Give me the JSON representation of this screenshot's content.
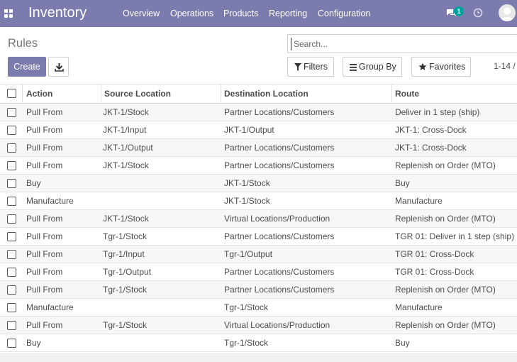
{
  "navbar": {
    "app_title": "Inventory",
    "menu": [
      "Overview",
      "Operations",
      "Products",
      "Reporting",
      "Configuration"
    ],
    "chat_badge": "1",
    "color": "#7c7bad"
  },
  "control_panel": {
    "breadcrumb": "Rules",
    "search_placeholder": "Search...",
    "create_label": "Create",
    "filters_label": "Filters",
    "group_by_label": "Group By",
    "favorites_label": "Favorites",
    "pager": "1-14 /"
  },
  "table": {
    "columns": [
      "Action",
      "Source Location",
      "Destination Location",
      "Route"
    ],
    "rows": [
      {
        "action": "Pull From",
        "source": "JKT-1/Stock",
        "destination": "Partner Locations/Customers",
        "route": "Deliver in 1 step (ship)"
      },
      {
        "action": "Pull From",
        "source": "JKT-1/Input",
        "destination": "JKT-1/Output",
        "route": "JKT-1: Cross-Dock"
      },
      {
        "action": "Pull From",
        "source": "JKT-1/Output",
        "destination": "Partner Locations/Customers",
        "route": "JKT-1: Cross-Dock"
      },
      {
        "action": "Pull From",
        "source": "JKT-1/Stock",
        "destination": "Partner Locations/Customers",
        "route": "Replenish on Order (MTO)"
      },
      {
        "action": "Buy",
        "source": "",
        "destination": "JKT-1/Stock",
        "route": "Buy"
      },
      {
        "action": "Manufacture",
        "source": "",
        "destination": "JKT-1/Stock",
        "route": "Manufacture"
      },
      {
        "action": "Pull From",
        "source": "JKT-1/Stock",
        "destination": "Virtual Locations/Production",
        "route": "Replenish on Order (MTO)"
      },
      {
        "action": "Pull From",
        "source": "Tgr-1/Stock",
        "destination": "Partner Locations/Customers",
        "route": "TGR 01: Deliver in 1 step (ship)"
      },
      {
        "action": "Pull From",
        "source": "Tgr-1/Input",
        "destination": "Tgr-1/Output",
        "route": "TGR 01: Cross-Dock"
      },
      {
        "action": "Pull From",
        "source": "Tgr-1/Output",
        "destination": "Partner Locations/Customers",
        "route": "TGR 01: Cross-Dock"
      },
      {
        "action": "Pull From",
        "source": "Tgr-1/Stock",
        "destination": "Partner Locations/Customers",
        "route": "Replenish on Order (MTO)"
      },
      {
        "action": "Manufacture",
        "source": "",
        "destination": "Tgr-1/Stock",
        "route": "Manufacture"
      },
      {
        "action": "Pull From",
        "source": "Tgr-1/Stock",
        "destination": "Virtual Locations/Production",
        "route": "Replenish on Order (MTO)"
      },
      {
        "action": "Buy",
        "source": "",
        "destination": "Tgr-1/Stock",
        "route": "Buy"
      }
    ]
  }
}
